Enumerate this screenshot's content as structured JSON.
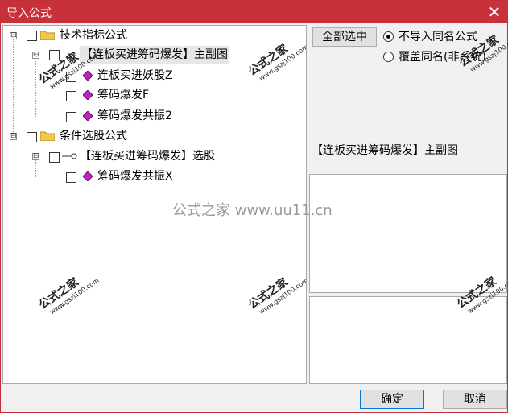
{
  "window": {
    "title": "导入公式",
    "close_glyph": "✕",
    "accent": "#c8313a"
  },
  "tree": {
    "nodes": [
      {
        "label": "技术指标公式",
        "expander": "⊟",
        "icon": "folder-icon"
      },
      {
        "label": "【连板买进筹码爆发】主副图",
        "expander": "⊟",
        "icon": "formula-group"
      },
      {
        "label": "连板买进妖股Z",
        "icon": "gem-icon"
      },
      {
        "label": "筹码爆发F",
        "icon": "gem-icon"
      },
      {
        "label": "筹码爆发共振2",
        "icon": "gem-icon"
      },
      {
        "label": "条件选股公式",
        "expander": "⊟",
        "icon": "folder-icon"
      },
      {
        "label": "【连板买进筹码爆发】选股",
        "expander": "⊟",
        "icon": "key-icon"
      },
      {
        "label": "筹码爆发共振X",
        "icon": "gem-icon"
      }
    ]
  },
  "options": {
    "select_all": "全部选中",
    "radio1": "不导入同名公式",
    "radio2": "覆盖同名(非系统)"
  },
  "info": {
    "selected_name": "【连板买进筹码爆发】主副图"
  },
  "footer": {
    "ok": "确定",
    "cancel": "取消"
  },
  "watermarks": {
    "brand": "公式之家",
    "site": "www.gszj100.com",
    "center": "公式之家 www.uu11.cn"
  }
}
